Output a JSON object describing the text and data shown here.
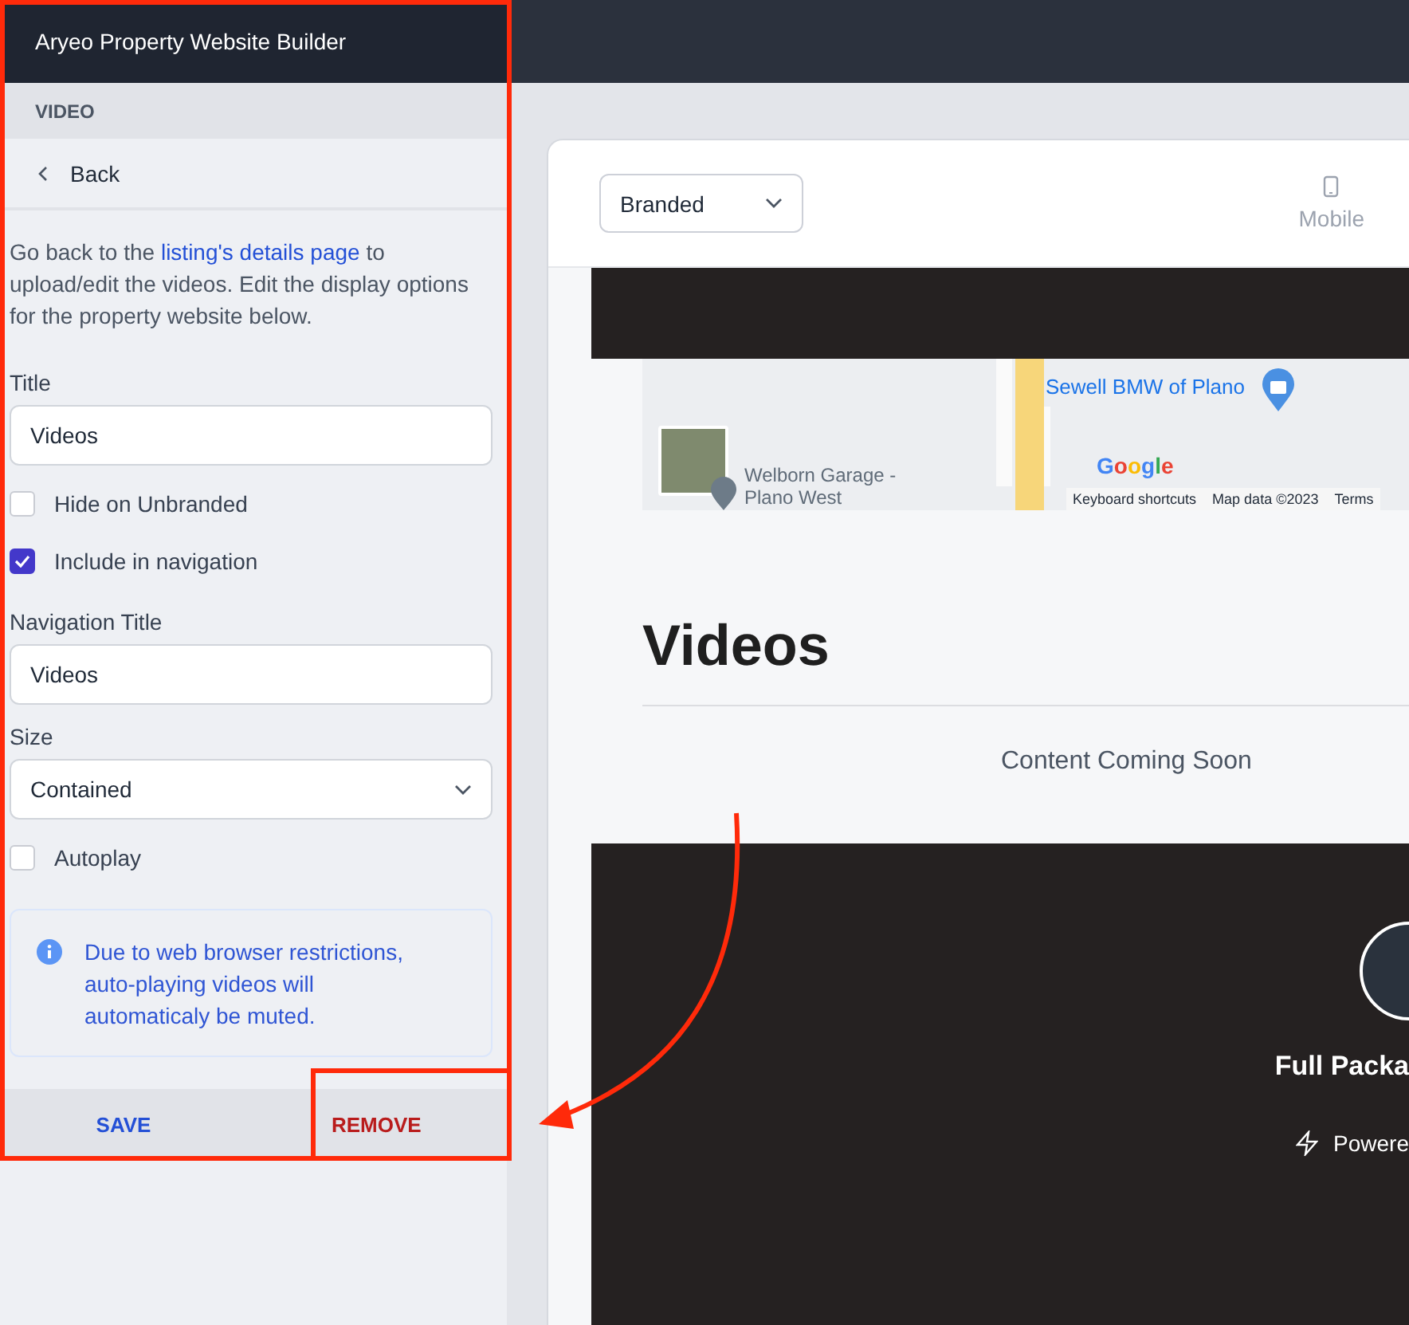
{
  "window": {
    "title": "Aryeo Property Website Builder"
  },
  "panel": {
    "section": "VIDEO",
    "back": "Back",
    "intro": {
      "before": "Go back to the ",
      "link": "listing's details page",
      "after": " to upload/edit the videos. Edit the display options for the property website below."
    },
    "fields": [
      {
        "kind": "text",
        "label": "Title",
        "value": "Videos"
      },
      {
        "kind": "checkbox",
        "label": "Hide on Unbranded",
        "checked": false
      },
      {
        "kind": "checkbox",
        "label": "Include in navigation",
        "checked": true
      },
      {
        "kind": "text",
        "label": "Navigation Title",
        "value": "Videos"
      },
      {
        "kind": "select",
        "label": "Size",
        "value": "Contained"
      },
      {
        "kind": "checkbox",
        "label": "Autoplay",
        "checked": false
      },
      {
        "kind": "notice",
        "text": "Due to web browser restrictions, auto-playing videos will automaticaly be muted."
      }
    ],
    "actions": [
      {
        "kind": "primary",
        "label": "SAVE"
      },
      {
        "kind": "danger",
        "label": "REMOVE"
      }
    ]
  },
  "preview": {
    "mode": "Branded",
    "device": "Mobile",
    "map": {
      "place": "Sewell BMW of Plano",
      "garage": "Welborn Garage - Plano West",
      "logo": "Google",
      "shortcuts": "Keyboard shortcuts",
      "attribution": "Map data ©2023",
      "terms": "Terms"
    },
    "heading": "Videos",
    "empty_text": "Content Coming Soon",
    "footer": {
      "company": "Full Packa",
      "powered": "Powere"
    }
  }
}
